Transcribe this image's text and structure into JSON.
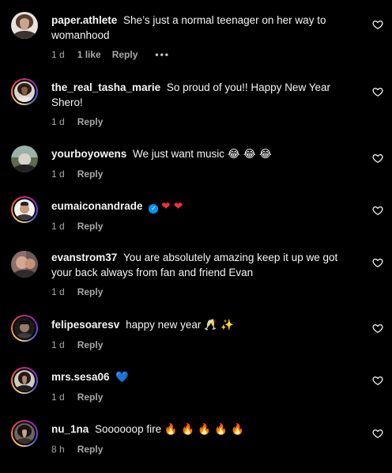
{
  "colors": {
    "background": "#000000",
    "text": "#f5f5f5",
    "secondary": "#a8a8a8",
    "verified": "#0095f6",
    "ring": "#d62976"
  },
  "comments": [
    {
      "username": "paper.athlete",
      "text": "She’s just a normal teenager on her way to womanhood",
      "emoji": "",
      "time": "1 d",
      "likes": "1 like",
      "reply": "Reply",
      "more": "•••",
      "icon": "heart-outline-icon"
    },
    {
      "username": "the_real_tasha_marie",
      "text": "So proud of you!! Happy New Year Shero!",
      "emoji": "",
      "time": "1 d",
      "reply": "Reply",
      "icon": "heart-outline-icon"
    },
    {
      "username": "yourboyowens",
      "text": "We just want music",
      "emoji": "😂 😂 😂",
      "time": "1 d",
      "reply": "Reply",
      "icon": "heart-outline-icon"
    },
    {
      "username": "eumaiconandrade",
      "verified": "✓",
      "text": "",
      "emoji": "❤ ❤",
      "time": "1 d",
      "reply": "Reply",
      "icon": "heart-outline-icon"
    },
    {
      "username": "evanstrom37",
      "text": "You are absolutely amazing keep it up we got your back always from fan and friend Evan",
      "emoji": "",
      "time": "1 d",
      "reply": "Reply",
      "icon": "heart-outline-icon"
    },
    {
      "username": "felipesoaresv",
      "text": "happy new year",
      "emoji": "🥂 ✨",
      "time": "1 d",
      "reply": "Reply",
      "icon": "heart-outline-icon"
    },
    {
      "username": "mrs.sesa06",
      "text": "",
      "emoji": "💙",
      "time": "1 d",
      "reply": "Reply",
      "icon": "heart-outline-icon"
    },
    {
      "username": "nu_1na",
      "text": "Soooooop fire",
      "emoji": "🔥 🔥 🔥 🔥 🔥",
      "time": "8 h",
      "reply": "Reply",
      "icon": "heart-outline-icon"
    }
  ]
}
